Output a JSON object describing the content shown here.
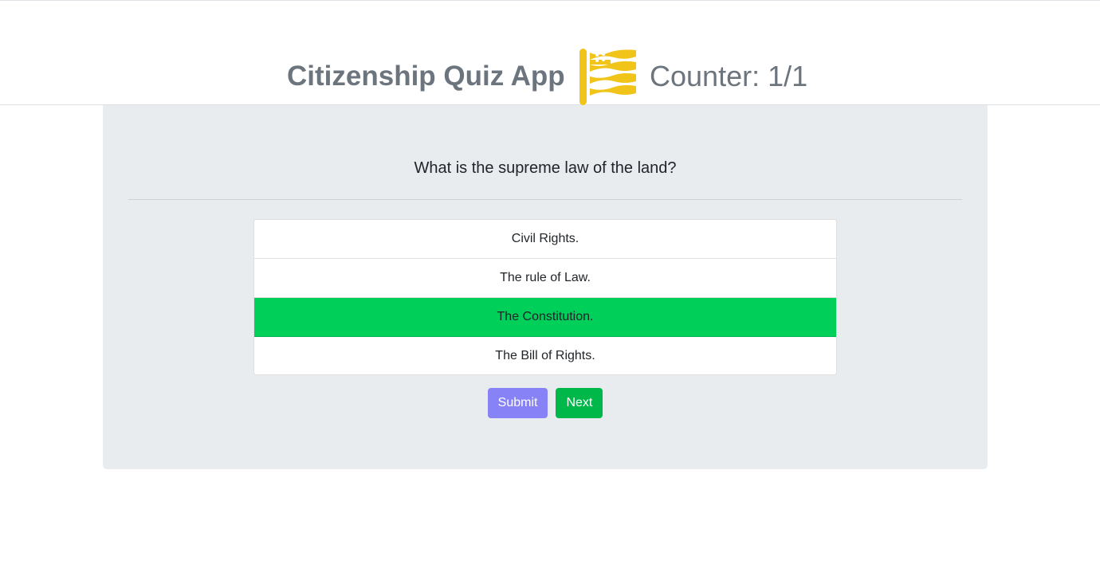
{
  "header": {
    "title": "Citizenship Quiz App",
    "flag_icon": "us-flag-icon",
    "counter": "Counter: 1/1"
  },
  "quiz": {
    "question": "What is the supreme law of the land?",
    "answers": [
      {
        "label": "Civil Rights."
      },
      {
        "label": "The rule of Law."
      },
      {
        "label": "The Constitution.",
        "selected": true
      },
      {
        "label": "The Bill of Rights."
      }
    ],
    "submit_label": "Submit",
    "next_label": "Next"
  },
  "colors": {
    "flag": "#f0c419",
    "selected_answer": "#00cf5a",
    "submit_button": "#8782f6",
    "next_button": "#00b84a",
    "title_text": "#6c757d",
    "panel_bg": "#e9ecef"
  }
}
